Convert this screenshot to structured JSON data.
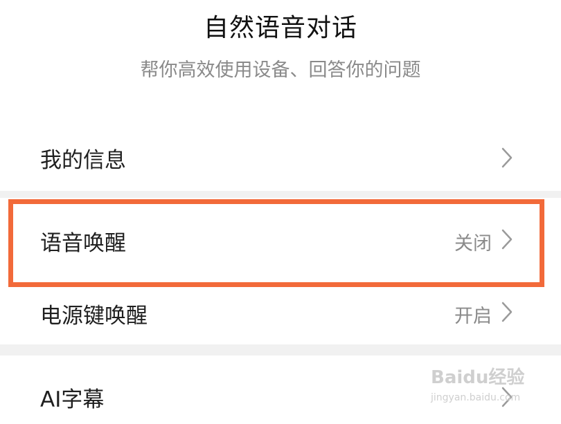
{
  "header": {
    "title": "自然语音对话",
    "subtitle": "帮你高效使用设备、回答你的问题"
  },
  "settings": {
    "my_info": {
      "label": "我的信息",
      "value": ""
    },
    "voice_wake": {
      "label": "语音唤醒",
      "value": "关闭"
    },
    "power_key_wake": {
      "label": "电源键唤醒",
      "value": "开启"
    },
    "ai_subtitles": {
      "label": "AI字幕",
      "value": ""
    }
  },
  "watermark": {
    "brand": "Baidu经验",
    "url": "jingyan.baidu.com"
  },
  "colors": {
    "highlight": "#f26a3a",
    "section_gap": "#f1f1f1",
    "secondary_text": "#8a8a8a",
    "primary_text": "#1f1f1f"
  },
  "icons": {
    "row_chevron": "chevron-right-icon"
  }
}
